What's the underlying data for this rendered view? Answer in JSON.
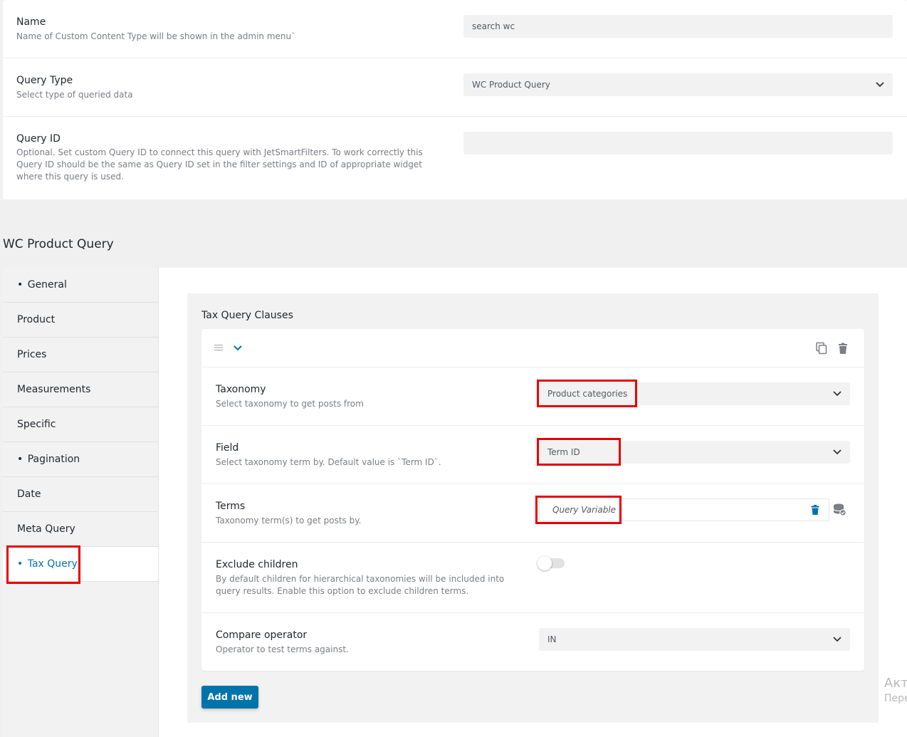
{
  "top": {
    "name": {
      "label": "Name",
      "desc": "Name of Custom Content Type will be shown in the admin menu`",
      "value": "search wc"
    },
    "query_type": {
      "label": "Query Type",
      "desc": "Select type of queried data",
      "value": "WC Product Query"
    },
    "query_id": {
      "label": "Query ID",
      "desc": "Optional. Set custom Query ID to connect this query with JetSmartFilters. To work correctly this Query ID should be the same as Query ID set in the filter settings and ID of appropriate widget where this query is used.",
      "value": ""
    }
  },
  "section_title": "WC Product Query",
  "tabs": [
    {
      "label": "General",
      "dot": true
    },
    {
      "label": "Product",
      "dot": false
    },
    {
      "label": "Prices",
      "dot": false
    },
    {
      "label": "Measurements",
      "dot": false
    },
    {
      "label": "Specific",
      "dot": false
    },
    {
      "label": "Pagination",
      "dot": true
    },
    {
      "label": "Date",
      "dot": false
    },
    {
      "label": "Meta Query",
      "dot": false
    },
    {
      "label": "Tax Query",
      "dot": true,
      "active": true
    }
  ],
  "tax_query": {
    "title": "Tax Query Clauses",
    "taxonomy": {
      "label": "Taxonomy",
      "desc": "Select taxonomy to get posts from",
      "value": "Product categories"
    },
    "field": {
      "label": "Field",
      "desc": "Select taxonomy term by. Default value is `Term ID`.",
      "value": "Term ID"
    },
    "terms": {
      "label": "Terms",
      "desc": "Taxonomy term(s) to get posts by.",
      "value": "Query Variable"
    },
    "exclude_children": {
      "label": "Exclude children",
      "desc": "By default children for hierarchical taxonomies will be included into query results. Enable this option to exclude children terms.",
      "enabled": false
    },
    "compare": {
      "label": "Compare operator",
      "desc": "Operator to test terms against.",
      "value": "IN"
    },
    "add_new_label": "Add new"
  },
  "watermark": {
    "line1": "Акт",
    "line2": "Пере"
  },
  "colors": {
    "accent": "#0073aa",
    "highlight": "#e50000",
    "field_bg": "#f2f2f2"
  }
}
